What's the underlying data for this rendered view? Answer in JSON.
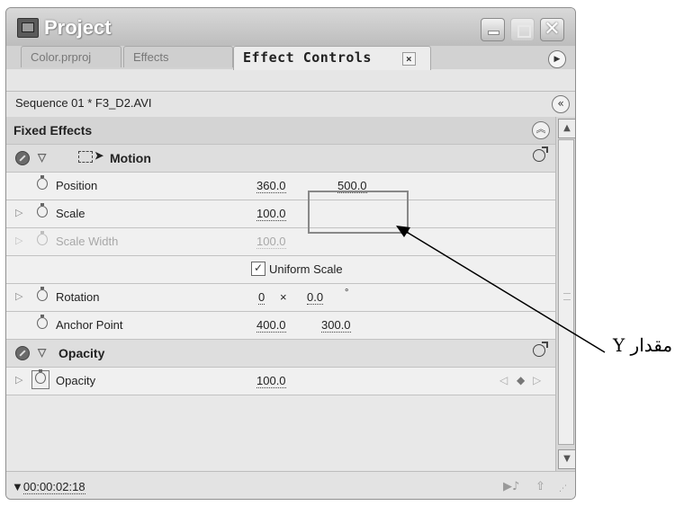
{
  "window": {
    "title": "Project",
    "icon": "project-film-icon"
  },
  "tabs": [
    {
      "label": "Color.prproj"
    },
    {
      "label": "Effects"
    },
    {
      "label": "Effect Controls",
      "close_glyph": "×"
    }
  ],
  "sequence": {
    "label": "Sequence 01 * F3_D2.AVI"
  },
  "fixed_effects": {
    "label": "Fixed Effects"
  },
  "motion": {
    "label": "Motion",
    "position": {
      "label": "Position",
      "x": "360.0",
      "y": "500.0"
    },
    "scale": {
      "label": "Scale",
      "value": "100.0"
    },
    "scale_width": {
      "label": "Scale Width",
      "value": "100.0"
    },
    "uniform_scale": {
      "label": "Uniform Scale",
      "checked": true
    },
    "rotation": {
      "label": "Rotation",
      "turns": "0",
      "times": "×",
      "degrees": "0.0",
      "deg_sign": "°"
    },
    "anchor_point": {
      "label": "Anchor Point",
      "x": "400.0",
      "y": "300.0"
    }
  },
  "opacity_section": {
    "label": "Opacity",
    "opacity": {
      "label": "Opacity",
      "value": "100.0"
    }
  },
  "footer": {
    "timecode": "00:00:02:18"
  },
  "annotation": {
    "label": "مقدار Y"
  },
  "colors": {
    "panel_bg": "#e6e6e6",
    "title_text": "#ffffff",
    "highlight_box": "#888888"
  }
}
